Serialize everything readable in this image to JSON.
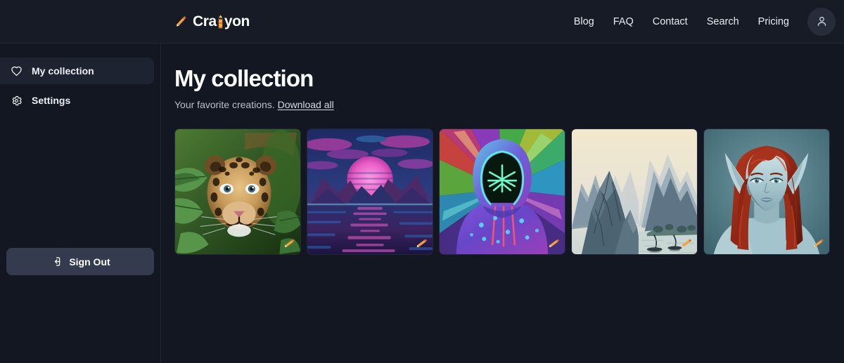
{
  "header": {
    "brand": {
      "prefix": "Cra",
      "icon": "crayon-pencil-i",
      "suffix": "yon",
      "full": "Craiyon"
    },
    "nav": [
      {
        "label": "Blog",
        "name": "nav-link-blog"
      },
      {
        "label": "FAQ",
        "name": "nav-link-faq"
      },
      {
        "label": "Contact",
        "name": "nav-link-contact"
      },
      {
        "label": "Search",
        "name": "nav-link-search"
      },
      {
        "label": "Pricing",
        "name": "nav-link-pricing"
      }
    ],
    "avatar_icon": "user-icon"
  },
  "sidebar": {
    "items": [
      {
        "label": "My collection",
        "icon": "heart-icon",
        "active": true
      },
      {
        "label": "Settings",
        "icon": "gear-icon",
        "active": false
      }
    ],
    "sign_out": {
      "label": "Sign Out",
      "icon": "logout-icon"
    }
  },
  "main": {
    "title": "My collection",
    "subtitle_text": "Your favorite creations.",
    "download_all_label": "Download all"
  },
  "gallery": {
    "watermark_icon": "pencil-icon",
    "items": [
      {
        "alt": "Jaguar peering through green jungle foliage",
        "name": "collection-image-jaguar"
      },
      {
        "alt": "Synthwave magenta sun setting over water between mountains",
        "name": "collection-image-synthwave-sunset"
      },
      {
        "alt": "Neon hooded figure with glowing mask on colorful background",
        "name": "collection-image-neon-hoodie"
      },
      {
        "alt": "Chinese ink wash painting of karst mountains and boats",
        "name": "collection-image-ink-landscape"
      },
      {
        "alt": "Blue skinned elf woman with long red hair",
        "name": "collection-image-elf-portrait"
      }
    ]
  },
  "colors": {
    "page_bg": "#121722",
    "header_bg": "#161b26",
    "sidebar_active_bg": "#1e2331",
    "signout_bg": "#353b4f",
    "accent_orange": "#f08a24",
    "text_primary": "#ffffff",
    "text_muted": "#b9bfcd",
    "border": "#232936"
  }
}
